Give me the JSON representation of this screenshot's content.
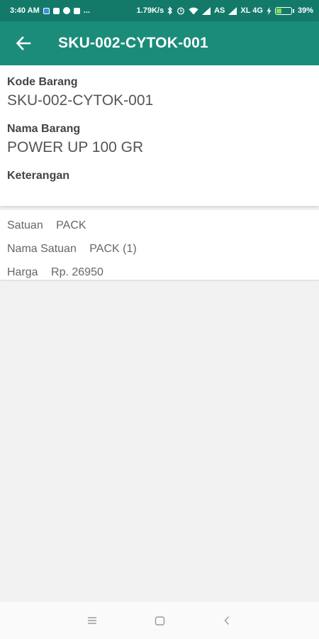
{
  "status_bar": {
    "time": "3:40 AM",
    "more": "...",
    "speed": "1.79K/s",
    "carrier1": "AS",
    "carrier2": "XL 4G",
    "battery": "39%",
    "battery_level": 0.39
  },
  "app_bar": {
    "title": "SKU-002-CYTOK-001"
  },
  "detail": {
    "kode_label": "Kode Barang",
    "kode_value": "SKU-002-CYTOK-001",
    "nama_label": "Nama Barang",
    "nama_value": "POWER UP 100 GR",
    "keterangan_label": "Keterangan",
    "keterangan_value": ""
  },
  "unit": {
    "satuan_label": "Satuan",
    "satuan_value": "PACK",
    "nama_satuan_label": "Nama Satuan",
    "nama_satuan_value": "PACK (1)",
    "harga_label": "Harga",
    "harga_value": "Rp. 26950"
  },
  "colors": {
    "status_bar": "#137a6a",
    "app_bar": "#1b8c7a",
    "background": "#f2f2f2"
  },
  "icons": {
    "back": "arrow-left-icon",
    "nav_menu": "menu-icon",
    "nav_home": "home-square-icon",
    "nav_back": "chevron-left-icon"
  }
}
